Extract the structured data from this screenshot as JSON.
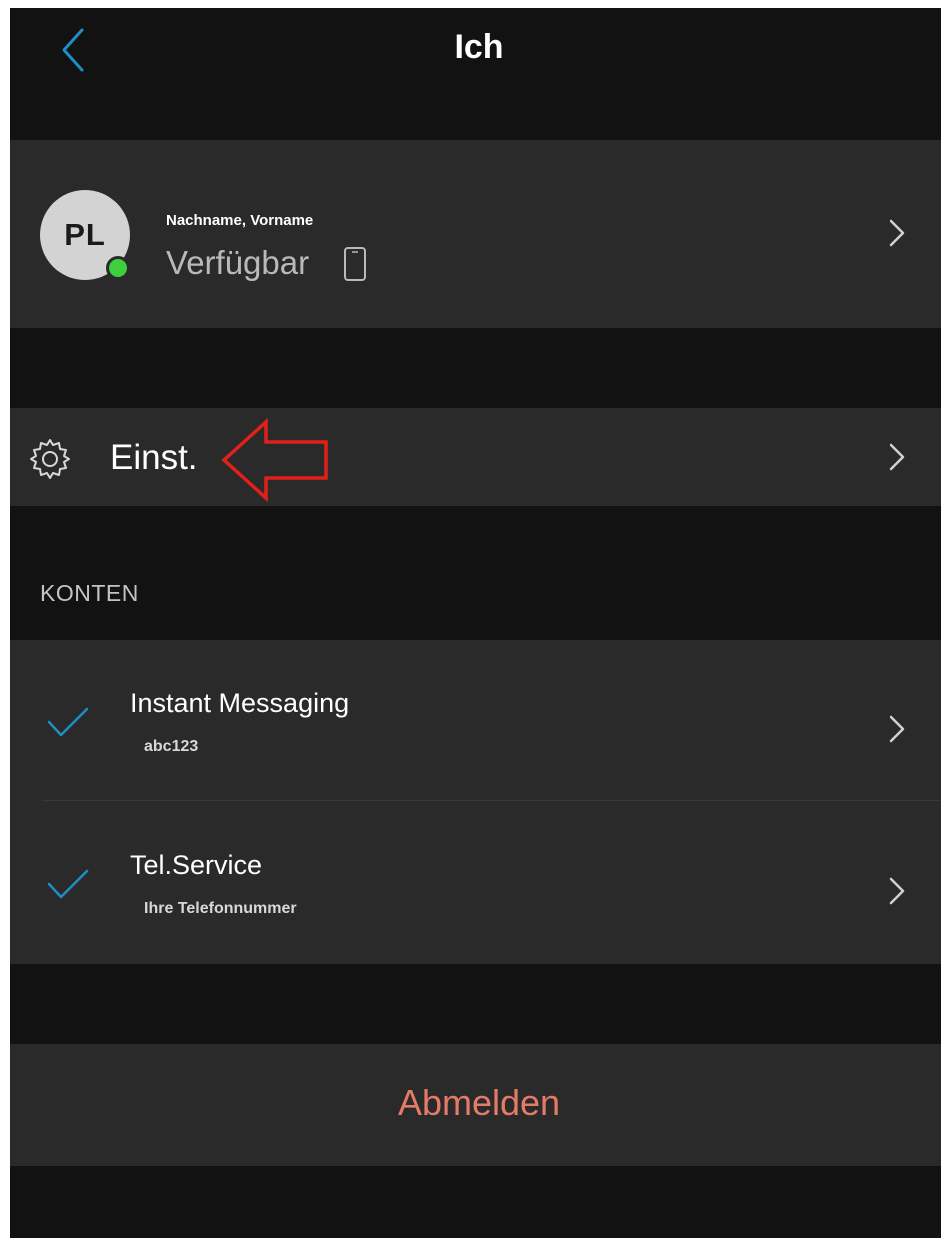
{
  "header": {
    "title": "Ich"
  },
  "profile": {
    "initials": "PL",
    "name": "Nachname, Vorname",
    "status": "Verfügbar",
    "presence_color": "#3ecf3e"
  },
  "settings": {
    "label": "Einst."
  },
  "accounts": {
    "header": "KONTEN",
    "items": [
      {
        "title": "Instant Messaging",
        "subtitle": "abc123"
      },
      {
        "title": "Tel.Service",
        "subtitle": "Ihre Telefonnummer"
      }
    ]
  },
  "logout": {
    "label": "Abmelden"
  },
  "colors": {
    "background": "#121212",
    "cell": "#2a2a2a",
    "accent": "#1e8fc4",
    "destructive": "#e57b66",
    "annotation_arrow": "#e0201b"
  },
  "icons": [
    "back-chevron-icon",
    "chevron-right-icon",
    "phone-device-icon",
    "gear-icon",
    "checkmark-icon",
    "red-arrow-annotation"
  ]
}
